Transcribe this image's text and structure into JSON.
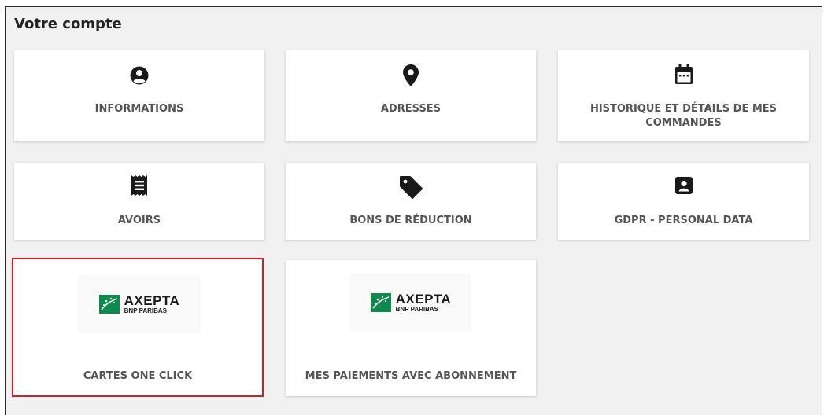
{
  "page": {
    "title": "Votre compte"
  },
  "tiles": [
    {
      "label": "INFORMATIONS",
      "icon": "user-circle-icon"
    },
    {
      "label": "ADRESSES",
      "icon": "map-marker-icon"
    },
    {
      "label": "HISTORIQUE ET DÉTAILS DE MES COMMANDES",
      "icon": "calendar-icon"
    },
    {
      "label": "AVOIRS",
      "icon": "receipt-icon"
    },
    {
      "label": "BONS DE RÉDUCTION",
      "icon": "tag-icon"
    },
    {
      "label": "GDPR - PERSONAL DATA",
      "icon": "contact-card-icon"
    },
    {
      "label": "CARTES ONE CLICK",
      "icon": "axepta-logo",
      "selected": true
    },
    {
      "label": "MES PAIEMENTS AVEC ABONNEMENT",
      "icon": "axepta-logo"
    }
  ],
  "logo": {
    "brand": "AXEPTA",
    "sub": "BNP PARIBAS",
    "color": "#0e8a4d"
  },
  "colors": {
    "selected_border": "#e0191e",
    "background": "#f1f1f1"
  }
}
